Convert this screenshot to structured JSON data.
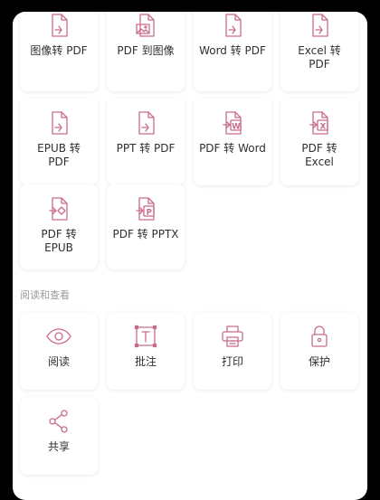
{
  "convert": {
    "items": [
      {
        "label": "图像转 PDF",
        "icon": "image-to-pdf-icon"
      },
      {
        "label": "PDF 到图像",
        "icon": "pdf-to-image-icon"
      },
      {
        "label": "Word 转 PDF",
        "icon": "word-to-pdf-icon"
      },
      {
        "label": "Excel 转 PDF",
        "icon": "excel-to-pdf-icon"
      },
      {
        "label": "EPUB 转 PDF",
        "icon": "epub-to-pdf-icon"
      },
      {
        "label": "PPT 转 PDF",
        "icon": "ppt-to-pdf-icon"
      },
      {
        "label": "PDF 转 Word",
        "icon": "pdf-to-word-icon"
      },
      {
        "label": "PDF 转 Excel",
        "icon": "pdf-to-excel-icon"
      },
      {
        "label": "PDF 转 EPUB",
        "icon": "pdf-to-epub-icon"
      },
      {
        "label": "PDF 转 PPTX",
        "icon": "pdf-to-pptx-icon"
      }
    ]
  },
  "read_view": {
    "title": "阅读和查看",
    "items": [
      {
        "label": "阅读",
        "icon": "eye-icon"
      },
      {
        "label": "批注",
        "icon": "annotate-icon"
      },
      {
        "label": "打印",
        "icon": "printer-icon"
      },
      {
        "label": "保护",
        "icon": "lock-icon"
      },
      {
        "label": "共享",
        "icon": "share-icon"
      }
    ]
  },
  "colors": {
    "accent": "#c96b8b",
    "background": "#ffffff",
    "frame": "#000000"
  }
}
